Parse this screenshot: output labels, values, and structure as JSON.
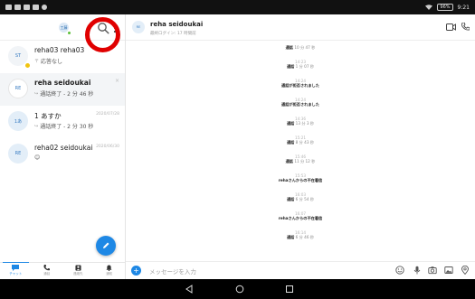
{
  "statusbar": {
    "battery": "96%",
    "time": "9:21"
  },
  "left": {
    "me_initials": "工藤",
    "me_grey": "4",
    "chats": [
      {
        "initials": "ST",
        "name": "reha03 reha03",
        "preview_symbol": "〒",
        "preview": "応答なし",
        "date": "",
        "bold": false,
        "selected": false
      },
      {
        "initials": "RE",
        "name": "reha seidoukai",
        "preview_symbol": "↪",
        "preview": "通話終了 - 2 分 46 秒",
        "date": "",
        "bold": true,
        "selected": true,
        "close": "×"
      },
      {
        "initials": "1あ",
        "name": "1 あすか",
        "preview_symbol": "↪",
        "preview": "通話終了 - 2 分 30 秒",
        "date": "2020/07/28",
        "bold": false,
        "selected": false
      },
      {
        "initials": "RE",
        "name": "reha02 seidoukai",
        "preview_symbol": "",
        "preview": "😊",
        "date": "2020/06/30",
        "bold": false,
        "selected": false
      }
    ],
    "tabs": [
      {
        "label": "チャット",
        "icon": "chat-icon",
        "active": true
      },
      {
        "label": "通話",
        "icon": "phone-icon",
        "active": false
      },
      {
        "label": "連絡先",
        "icon": "contacts-icon",
        "active": false
      },
      {
        "label": "通知",
        "icon": "bell-icon",
        "active": false
      }
    ]
  },
  "right": {
    "initials": "RE",
    "name": "reha seidoukai",
    "subtitle": "最終ログイン: 17 時間前",
    "messages": [
      {
        "kind": "call",
        "label": "通話",
        "dur": "10 分 47 秒"
      },
      {
        "kind": "time",
        "text": "14:23"
      },
      {
        "kind": "call",
        "label": "通話",
        "dur": "1 分 07 秒"
      },
      {
        "kind": "time",
        "text": "14:24"
      },
      {
        "kind": "bold",
        "text": "通話が拒否されました"
      },
      {
        "kind": "time",
        "text": "14:24"
      },
      {
        "kind": "bold",
        "text": "通話が拒否されました"
      },
      {
        "kind": "time",
        "text": "14:36"
      },
      {
        "kind": "call",
        "label": "通話",
        "dur": "13 分 3 秒"
      },
      {
        "kind": "time",
        "text": "15:21"
      },
      {
        "kind": "call",
        "label": "通話",
        "dur": "8 分 43 秒"
      },
      {
        "kind": "time",
        "text": "15:46"
      },
      {
        "kind": "call",
        "label": "通話",
        "dur": "11 分 12 秒"
      },
      {
        "kind": "time",
        "text": "15:53"
      },
      {
        "kind": "bold",
        "text": "rehaさんからの不在着信"
      },
      {
        "kind": "time",
        "text": "16:03"
      },
      {
        "kind": "call",
        "label": "通話",
        "dur": "6 分 54 秒"
      },
      {
        "kind": "time",
        "text": "16:07"
      },
      {
        "kind": "bold",
        "text": "rehaさんからの不在着信"
      },
      {
        "kind": "time",
        "text": "16:14"
      },
      {
        "kind": "call",
        "label": "通話",
        "dur": "6 分 46 秒"
      }
    ],
    "input_placeholder": "メッセージを入力"
  },
  "colors": {
    "accent": "#1e88e5",
    "annotation_ring": "#e00000",
    "status_online": "#5bbf3a",
    "status_away": "#f1c40f"
  }
}
